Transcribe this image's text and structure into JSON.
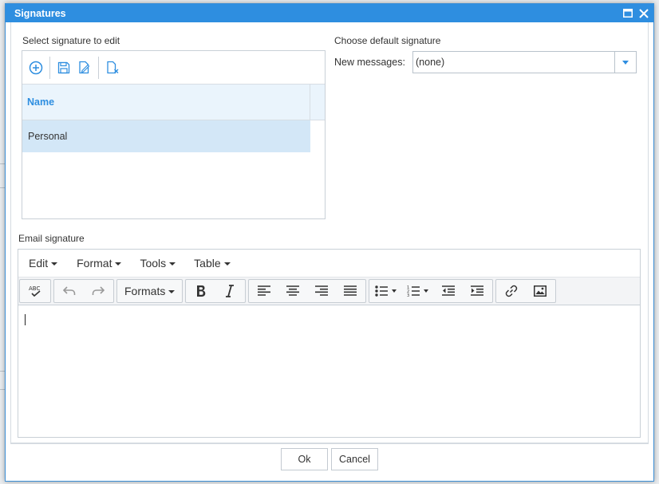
{
  "dialog": {
    "title": "Signatures"
  },
  "left_panel": {
    "label": "Select signature to edit",
    "toolbar": {
      "icons": [
        "add-circle-icon",
        "save-icon",
        "rename-icon",
        "delete-icon"
      ]
    },
    "grid": {
      "header": "Name",
      "rows": [
        "Personal"
      ]
    }
  },
  "right_panel": {
    "label": "Choose default signature",
    "new_messages_label": "New messages:",
    "new_messages_value": "(none)"
  },
  "editor": {
    "label": "Email signature",
    "menu": {
      "edit": "Edit",
      "format": "Format",
      "tools": "Tools",
      "table": "Table"
    },
    "toolbar": {
      "formats_label": "Formats",
      "spellcheck_icon_text": "ABC"
    },
    "content": ""
  },
  "footer": {
    "ok": "Ok",
    "cancel": "Cancel"
  },
  "colors": {
    "title_bar": "#2e8ee0",
    "accent": "#2e8ee0",
    "selected_row": "#d3e7f7",
    "grid_header": "#eaf4fc"
  }
}
